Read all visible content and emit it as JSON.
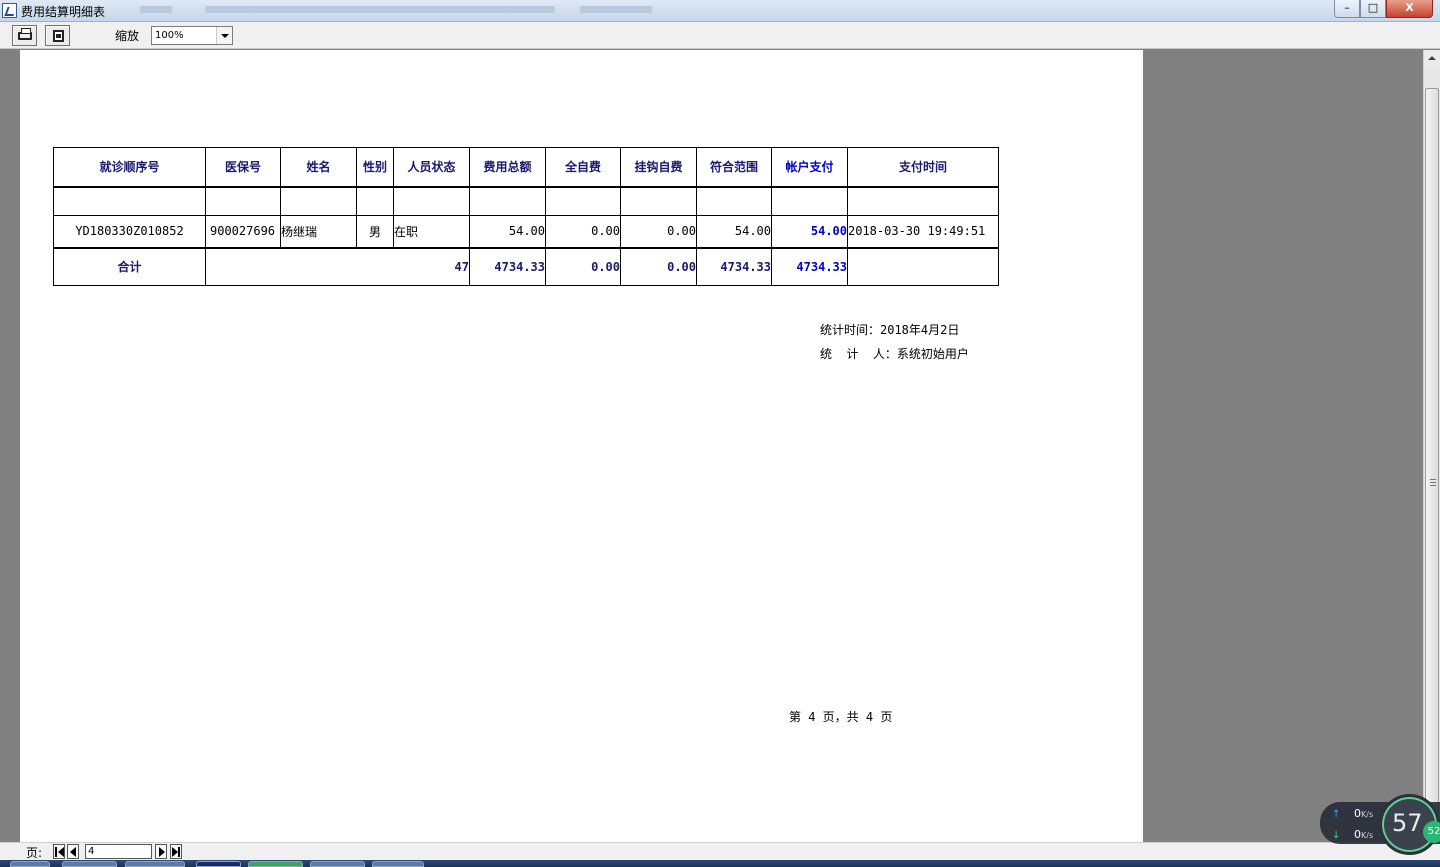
{
  "window": {
    "title": "费用结算明细表",
    "minimize_glyph": "–",
    "maximize_glyph": "□",
    "close_glyph": "X"
  },
  "toolbar": {
    "print_icon": "printer-icon",
    "export_icon": "export-icon",
    "zoom_label": "缩放",
    "zoom_value": "100%"
  },
  "report": {
    "columns": [
      "就诊顺序号",
      "医保号",
      "姓名",
      "性别",
      "人员状态",
      "费用总额",
      "全自费",
      "挂钩自费",
      "符合范围",
      "帐户支付",
      "支付时间"
    ],
    "rows": [
      {
        "seq": "YD180330Z010852",
        "insurance_no": "900027696",
        "name": "杨继瑞",
        "gender": "男",
        "status": "在职",
        "total": "54.00",
        "self_pay": "0.00",
        "linked_self_pay": "0.00",
        "in_scope": "54.00",
        "account_pay": "54.00",
        "pay_time": "2018-03-30 19:49:51"
      }
    ],
    "totals": {
      "label": "合计",
      "count": "47",
      "total": "4734.33",
      "self_pay": "0.00",
      "linked_self_pay": "0.00",
      "in_scope": "4734.33",
      "account_pay": "4734.33"
    },
    "stat_time": "统计时间：2018年4月2日",
    "stat_user": "统  计  人：系统初始用户",
    "page_footer": "第 4 页，共 4 页"
  },
  "pager": {
    "label": "页:",
    "current_page": "4"
  },
  "network_widget": {
    "upload": "0",
    "download": "0",
    "unit": "K/s",
    "gauge_value": "57",
    "badge_value": "52",
    "accent": "#2bb673"
  }
}
